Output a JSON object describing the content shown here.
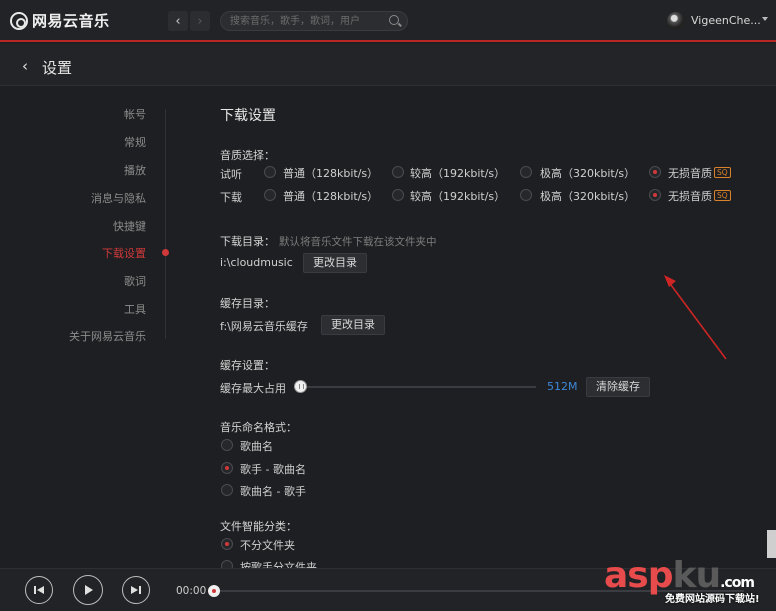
{
  "app": {
    "name": "网易云音乐"
  },
  "search": {
    "placeholder": "搜索音乐，歌手，歌词，用户"
  },
  "user": {
    "name": "VigeenChe..."
  },
  "header": {
    "title": "设置"
  },
  "sidebar": {
    "items": [
      {
        "label": "帐号",
        "active": false
      },
      {
        "label": "常规",
        "active": false
      },
      {
        "label": "播放",
        "active": false
      },
      {
        "label": "消息与隐私",
        "active": false
      },
      {
        "label": "快捷键",
        "active": false
      },
      {
        "label": "下载设置",
        "active": true
      },
      {
        "label": "歌词",
        "active": false
      },
      {
        "label": "工具",
        "active": false
      },
      {
        "label": "关于网易云音乐",
        "active": false
      }
    ]
  },
  "download": {
    "title": "下载设置",
    "quality_label": "音质选择：",
    "rows": [
      {
        "label": "试听",
        "options": [
          "普通（128kbit/s）",
          "较高（192kbit/s）",
          "极高（320kbit/s）",
          "无损音质"
        ],
        "selected": 3
      },
      {
        "label": "下载",
        "options": [
          "普通（128kbit/s）",
          "较高（192kbit/s）",
          "极高（320kbit/s）",
          "无损音质"
        ],
        "selected": 3
      }
    ],
    "sq_badge": "SQ",
    "dir_label": "下载目录：",
    "dir_hint": "默认将音乐文件下载在该文件夹中",
    "dir_path": "i:\\cloudmusic",
    "change_dir": "更改目录",
    "cache_dir_label": "缓存目录：",
    "cache_dir_path": "f:\\网易云音乐缓存",
    "cache_change_dir": "更改目录",
    "cache_settings_label": "缓存设置：",
    "cache_max_label": "缓存最大占用",
    "cache_max_value": "512M",
    "cache_level": 0,
    "clear_cache": "清除缓存",
    "naming_label": "音乐命名格式：",
    "naming_options": [
      "歌曲名",
      "歌手 - 歌曲名",
      "歌曲名 - 歌手"
    ],
    "naming_selected": 1,
    "classify_label": "文件智能分类：",
    "classify_options": [
      "不分文件夹",
      "按歌手分文件夹"
    ],
    "classify_selected": 0
  },
  "player": {
    "time": "00:00",
    "progress": 0
  },
  "watermark": {
    "main_a": "asp",
    "main_b": "ku",
    "main_dot": ".com",
    "sub": "免费网站源码下载站!"
  },
  "colors": {
    "accent": "#d0393a",
    "link": "#3e88d8",
    "badge": "#d9822b"
  }
}
